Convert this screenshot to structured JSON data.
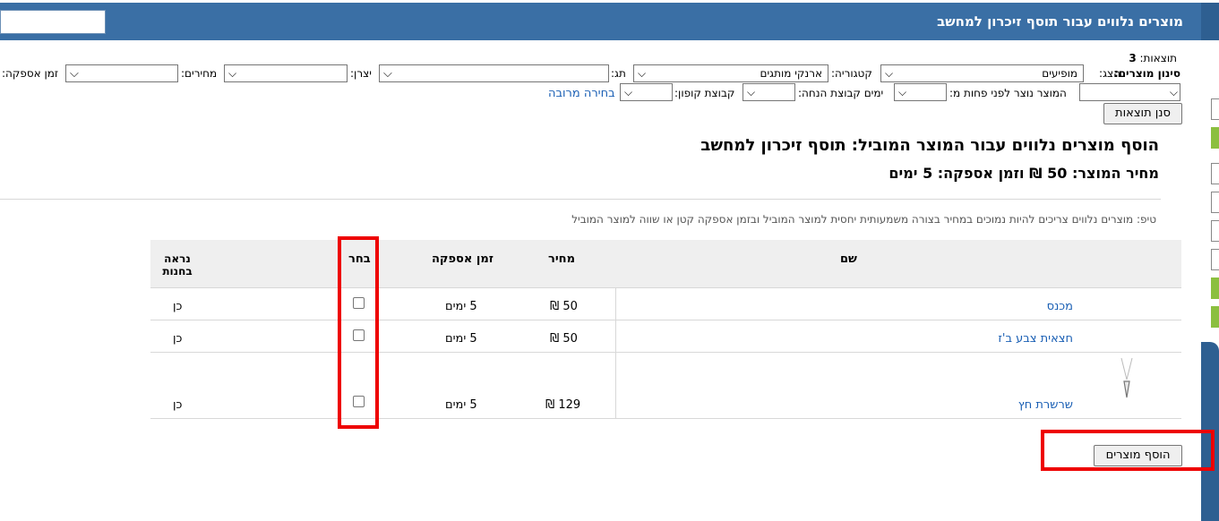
{
  "header": {
    "title": "מוצרים נלווים עבור תוסף זיכרון למחשב"
  },
  "results": {
    "label": "תוצאות:",
    "count": "3"
  },
  "filters": {
    "label": "סינון מוצרים:",
    "display_label": "הצג:",
    "display_value": "מופיעים",
    "category_label": "קטגוריה:",
    "category_value": "ארנקי מותגים",
    "tag_label": "תג:",
    "maker_label": "יצרן:",
    "prices_label": "מחירים:",
    "delivery_label": "זמן אספקה:",
    "created_label": "המוצר נוצר לפני פחות מ:",
    "discount_days_label": "ימים קבוצת הנחה:",
    "coupon_label": "קבוצת קופון:",
    "multi_select": "בחירה מרובה",
    "submit": "סנן תוצאות"
  },
  "section": {
    "heading": "הוסף מוצרים נלווים עבור המוצר המוביל: תוסף זיכרון למחשב",
    "subheading": "מחיר המוצר: 50 ₪ וזמן אספקה: 5 ימים",
    "tip": "טיפ: מוצרים נלווים צריכים להיות נמוכים במחיר בצורה משמעותית יחסית למוצר המוביל ובזמן אספקה קטן או שווה למוצר המוביל"
  },
  "table": {
    "headers": {
      "name": "שם",
      "price": "מחיר",
      "delivery": "זמן אספקה",
      "select": "בחר",
      "visible": "נראה בחנות"
    },
    "rows": [
      {
        "name": "מכנס",
        "price": "50 ₪",
        "delivery": "5 ימים",
        "visible": "כן"
      },
      {
        "name": "חצאית צבע ב'ז",
        "price": "50 ₪",
        "delivery": "5 ימים",
        "visible": "כן"
      },
      {
        "name": "שרשרת חץ",
        "price": "129 ₪",
        "delivery": "5 ימים",
        "visible": "כן"
      }
    ]
  },
  "actions": {
    "add": "הוסף מוצרים"
  },
  "icons": {
    "chevron": "chevron-down-icon",
    "necklace": "necklace-image"
  },
  "colors": {
    "header_bg": "#3a6fa5",
    "link": "#1a5fb4",
    "highlight": "#e00000",
    "sidebar_green": "#8cbf3f"
  }
}
